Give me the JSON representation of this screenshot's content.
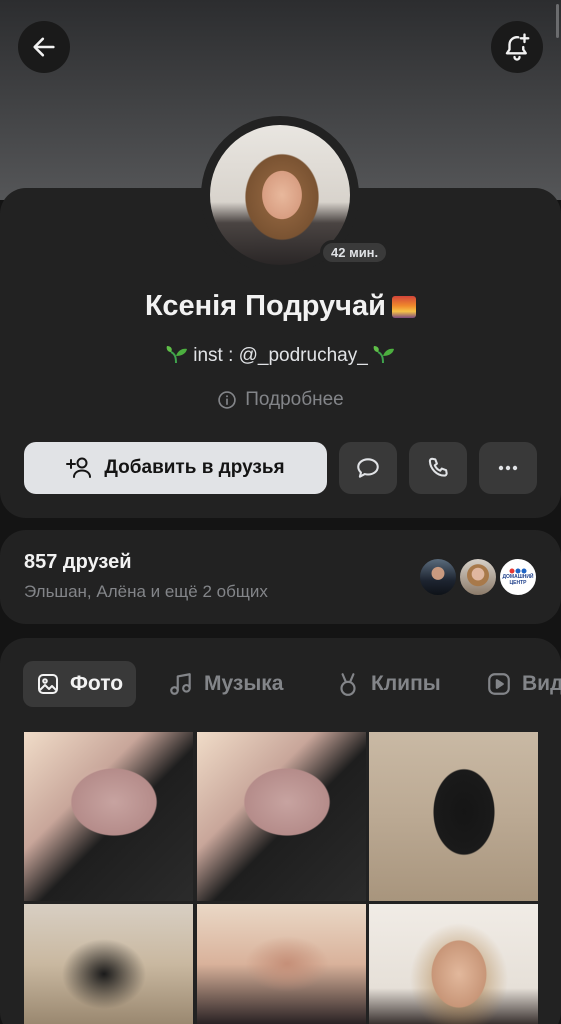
{
  "header": {
    "back_icon": "arrow-left-icon",
    "bell_icon": "bell-plus-icon"
  },
  "profile": {
    "last_seen": "42 мин.",
    "name": "Ксенія Подручай",
    "status_text": "inst : @_podruchay_",
    "details_label": "Подробнее"
  },
  "actions": {
    "add_friend_label": "Добавить в друзья",
    "message_icon": "message-bubble-icon",
    "call_icon": "phone-icon",
    "more_icon": "more-horizontal-icon"
  },
  "friends": {
    "count_label": "857 друзей",
    "common_label": "Эльшан, Алёна и ещё 2 общих",
    "badge_text_line1": "ДОМАШНИЙ",
    "badge_text_line2": "ЦЕНТР"
  },
  "tabs": [
    {
      "label": "Фото",
      "icon": "image-icon",
      "active": true
    },
    {
      "label": "Музыка",
      "icon": "music-note-icon",
      "active": false
    },
    {
      "label": "Клипы",
      "icon": "clips-icon",
      "active": false
    },
    {
      "label": "Вид",
      "icon": "video-icon",
      "active": false
    }
  ],
  "colors": {
    "background": "#141414",
    "card": "#222222",
    "primary_button": "#e1e3e6",
    "secondary_button": "#393939",
    "muted_text": "#838589"
  }
}
